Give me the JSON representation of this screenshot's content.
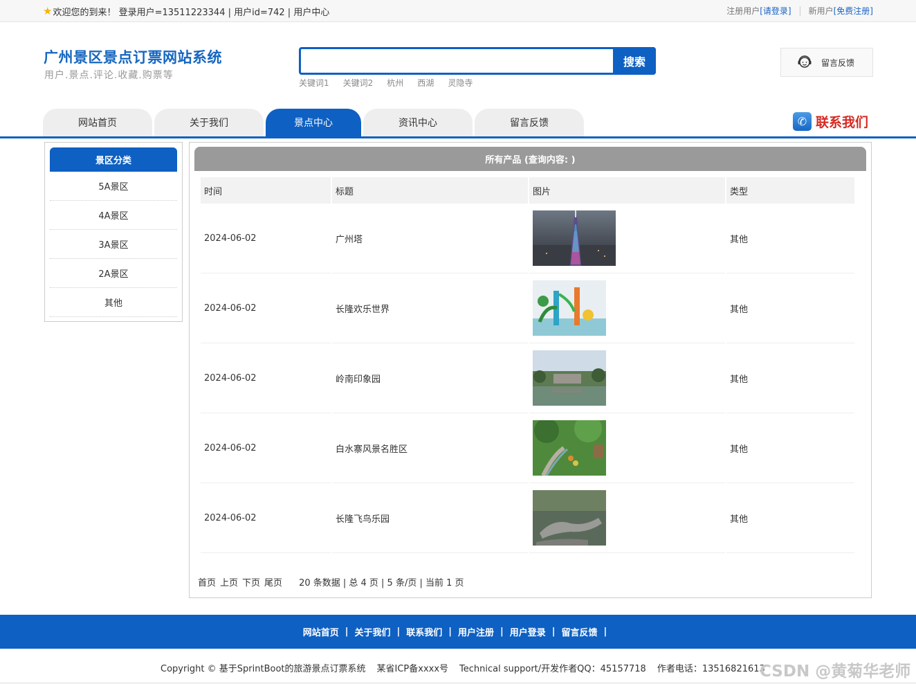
{
  "topbar": {
    "welcome": "欢迎您的到来！ 登录用户=13511223344 | 用户id=742 | 用户中心",
    "register_label": "注册用户",
    "login_link": "[请登录]",
    "new_user_label": "新用户",
    "signup_link": "[免费注册]"
  },
  "header": {
    "title": "广州景区景点订票网站系统",
    "subtitle": "用户.景点.评论.收藏.购票等",
    "search_placeholder": "",
    "search_button": "搜索",
    "keywords": [
      "关键词1",
      "关键词2",
      "杭州",
      "西湖",
      "灵隐寺"
    ],
    "feedback": "留言反馈"
  },
  "nav": {
    "tabs": [
      "网站首页",
      "关于我们",
      "景点中心",
      "资讯中心",
      "留言反馈"
    ],
    "active_index": 2,
    "contact": "联系我们"
  },
  "sidebar": {
    "title": "景区分类",
    "items": [
      "5A景区",
      "4A景区",
      "3A景区",
      "2A景区",
      "其他"
    ]
  },
  "main": {
    "heading": "所有产品 (查询内容: )",
    "columns": [
      "时间",
      "标题",
      "图片",
      "类型"
    ],
    "rows": [
      {
        "time": "2024-06-02",
        "title": "广州塔",
        "type": "其他"
      },
      {
        "time": "2024-06-02",
        "title": "长隆欢乐世界",
        "type": "其他"
      },
      {
        "time": "2024-06-02",
        "title": "岭南印象园",
        "type": "其他"
      },
      {
        "time": "2024-06-02",
        "title": "白水寨风景名胜区",
        "type": "其他"
      },
      {
        "time": "2024-06-02",
        "title": "长隆飞鸟乐园",
        "type": "其他"
      }
    ],
    "pager": {
      "first": "首页",
      "prev": "上页",
      "next": "下页",
      "last": "尾页",
      "info": "20 条数据 | 总 4 页 | 5 条/页 | 当前 1 页"
    }
  },
  "footer": {
    "links": [
      "网站首页",
      "关于我们",
      "联系我们",
      "用户注册",
      "用户登录",
      "留言反馈"
    ],
    "copyright": "Copyright © 基于SprintBoot的旅游景点订票系统",
    "icp": "某省ICP备xxxx号",
    "support": "Technical support/开发作者QQ：45157718",
    "phone": "作者电话：13516821613",
    "watermark": "CSDN @黄菊华老师"
  },
  "colors": {
    "brand_blue": "#0e60c2",
    "header_gray": "#9a9a9a",
    "contact_red": "#d42a22"
  }
}
